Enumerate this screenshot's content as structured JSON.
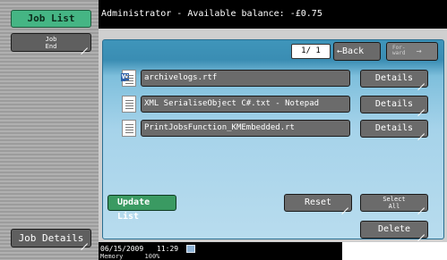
{
  "sidebar": {
    "active_tab": "Job List",
    "job_end": [
      "Job",
      "End"
    ],
    "job_details": "Job Details"
  },
  "status": {
    "text": "Administrator  -  Available balance: -£0.75"
  },
  "pager": {
    "page": "1/  1",
    "back": "Back",
    "forward": [
      "For-",
      "ward"
    ]
  },
  "files": [
    {
      "name": "archivelogs.rtf",
      "icon": "word-doc-icon",
      "details": "Details"
    },
    {
      "name": "XML SerialiseObject C#.txt - Notepad",
      "icon": "text-doc-icon",
      "details": "Details"
    },
    {
      "name": "PrintJobsFunction_KMEmbedded.rt",
      "icon": "text-doc-icon",
      "details": "Details"
    }
  ],
  "actions": {
    "update_list": "Update List",
    "reset": "Reset",
    "select_all": [
      "Select",
      "All"
    ],
    "delete": "Delete"
  },
  "footer": {
    "date": "06/15/2009",
    "time": "11:29",
    "memory_label": "Memory",
    "memory_value": "100%"
  },
  "colors": {
    "accent_green": "#45b584",
    "panel_blue": "#3f95ba",
    "button_gray": "#6b6b6b"
  }
}
